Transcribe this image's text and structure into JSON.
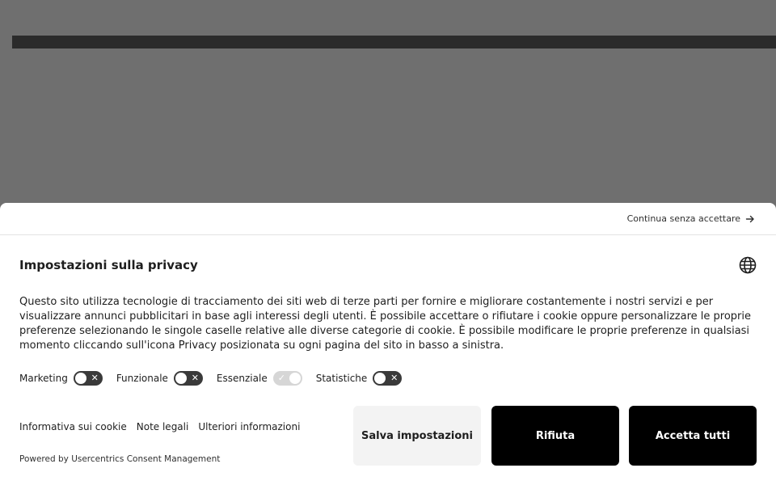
{
  "banner": {
    "continue_label": "Continua senza accettare",
    "title": "Impostazioni sulla privacy",
    "description": "Questo sito utilizza tecnologie di tracciamento dei siti web di terze parti per fornire e migliorare costantemente i nostri servizi e per visualizzare annunci pubblicitari in base agli interessi degli utenti. È possibile accettare o rifiutare i cookie oppure personalizzare le proprie preferenze selezionando le singole caselle relative alle diverse categorie di cookie.  È possibile modificare le proprie preferenze in qualsiasi momento cliccando sull'icona Privacy posizionata su ogni pagina del sito in basso a sinistra.",
    "toggles": [
      {
        "label": "Marketing",
        "state": "off"
      },
      {
        "label": "Funzionale",
        "state": "off"
      },
      {
        "label": "Essenziale",
        "state": "on-disabled"
      },
      {
        "label": "Statistiche",
        "state": "off"
      }
    ],
    "links": {
      "cookie_policy": "Informativa sui cookie",
      "legal_notes": "Note legali",
      "more_info": "Ulteriori informazioni"
    },
    "powered_by": "Powered by Usercentrics Consent Management",
    "buttons": {
      "save": "Salva impostazioni",
      "deny": "Rifiuta",
      "accept_all": "Accetta tutti"
    }
  },
  "icons": {
    "continue": "arrow-right-icon",
    "language": "globe-icon",
    "toggle_off": "close-icon",
    "toggle_on": "check-icon"
  },
  "colors": {
    "overlay": "#6f6f6f",
    "primary_button": "#000000",
    "secondary_button": "#f3f3f3",
    "toggle_off": "#3a3a3a",
    "toggle_disabled": "#d6d6d6"
  }
}
